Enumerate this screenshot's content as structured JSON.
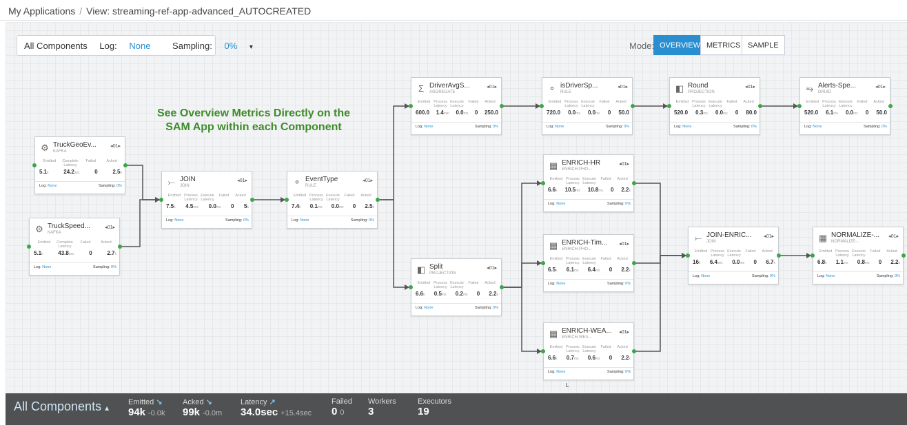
{
  "breadcrumb": {
    "root": "My Applications",
    "separator": "/",
    "current": "View: streaming-ref-app-advanced_AUTOCREATED"
  },
  "filter": {
    "components": "All Components",
    "log_label": "Log:",
    "log_value": "None",
    "sampling_label": "Sampling:",
    "sampling_value": "0%",
    "caret": "▾"
  },
  "mode": {
    "label": "Mode:",
    "options": [
      "OVERVIEW",
      "METRICS",
      "SAMPLE"
    ],
    "active": "OVERVIEW"
  },
  "callout": {
    "line1": "See Overview Metrics Directly on the",
    "line2": "SAM App within each Component"
  },
  "colors": {
    "accent": "#2a8fd1",
    "port": "#3ca64a",
    "callout": "#3e8b2b",
    "bottombar": "#4f5152"
  },
  "nodes": [
    {
      "id": "truckgeo",
      "name": "TruckGeoEv...",
      "type": "KAFKA",
      "icon": "kafka-icon",
      "parallelism": "01",
      "headers": [
        "Emitted",
        "Complete Latency",
        "Failed",
        "Acked"
      ],
      "values": [
        [
          "5.1",
          "k"
        ],
        [
          "24.2",
          "sec"
        ],
        [
          "0",
          ""
        ],
        [
          "2.5",
          "k"
        ]
      ],
      "log": "None",
      "sampling": "0%"
    },
    {
      "id": "truckspeed",
      "name": "TruckSpeed...",
      "type": "KAFKA",
      "icon": "kafka-icon",
      "parallelism": "01",
      "headers": [
        "Emitted",
        "Complete Latency",
        "Failed",
        "Acked"
      ],
      "values": [
        [
          "5.1",
          "k"
        ],
        [
          "43.8",
          "sec"
        ],
        [
          "0",
          ""
        ],
        [
          "2.7",
          "k"
        ]
      ],
      "log": "None",
      "sampling": "0%"
    },
    {
      "id": "join",
      "name": "JOIN",
      "type": "JOIN",
      "icon": "join-icon",
      "parallelism": "01",
      "headers": [
        "Emitted",
        "Process Latency",
        "Execute Latency",
        "Failed",
        "Acked"
      ],
      "values": [
        [
          "7.5",
          "k"
        ],
        [
          "4.5",
          "sec"
        ],
        [
          "0.0",
          "ms"
        ],
        [
          "0",
          ""
        ],
        [
          "5",
          "k"
        ]
      ],
      "log": "None",
      "sampling": "0%"
    },
    {
      "id": "eventtype",
      "name": "EventType",
      "type": "RULE",
      "icon": "rule-icon",
      "parallelism": "01",
      "headers": [
        "Emitted",
        "Process Latency",
        "Execute Latency",
        "Failed",
        "Acked"
      ],
      "values": [
        [
          "7.4",
          "k"
        ],
        [
          "0.1",
          "ms"
        ],
        [
          "0.0",
          "ms"
        ],
        [
          "0",
          ""
        ],
        [
          "2.5",
          "k"
        ]
      ],
      "log": "None",
      "sampling": "0%"
    },
    {
      "id": "driveravg",
      "name": "DriverAvgS...",
      "type": "AGGREGATE",
      "icon": "sigma-icon",
      "parallelism": "01",
      "headers": [
        "Emitted",
        "Process Latency",
        "Execute Latency",
        "Failed",
        "Acked"
      ],
      "values": [
        [
          "600.0",
          ""
        ],
        [
          "1.4",
          "min"
        ],
        [
          "0.0",
          "ms"
        ],
        [
          "0",
          ""
        ],
        [
          "250.0",
          ""
        ]
      ],
      "log": "None",
      "sampling": "0%"
    },
    {
      "id": "isdriver",
      "name": "isDriverSp...",
      "type": "RULE",
      "icon": "rule-icon",
      "parallelism": "01",
      "headers": [
        "Emitted",
        "Process Latency",
        "Execute Latency",
        "Failed",
        "Acked"
      ],
      "values": [
        [
          "720.0",
          ""
        ],
        [
          "0.0",
          "ms"
        ],
        [
          "0.0",
          "ms"
        ],
        [
          "0",
          ""
        ],
        [
          "50.0",
          ""
        ]
      ],
      "log": "None",
      "sampling": "0%"
    },
    {
      "id": "round",
      "name": "Round",
      "type": "PROJECTION",
      "icon": "projection-icon",
      "parallelism": "01",
      "headers": [
        "Emitted",
        "Process Latency",
        "Execute Latency",
        "Failed",
        "Acked"
      ],
      "values": [
        [
          "520.0",
          ""
        ],
        [
          "0.3",
          "ms"
        ],
        [
          "0.0",
          "ms"
        ],
        [
          "0",
          ""
        ],
        [
          "80.0",
          ""
        ]
      ],
      "log": "None",
      "sampling": "0%"
    },
    {
      "id": "alerts",
      "name": "Alerts-Spe...",
      "type": "DRUID",
      "icon": "druid-icon",
      "parallelism": "01",
      "headers": [
        "Emitted",
        "Process Latency",
        "Execute Latency",
        "Failed",
        "Acked"
      ],
      "values": [
        [
          "520.0",
          ""
        ],
        [
          "6.1",
          "ms"
        ],
        [
          "0.0",
          "ms"
        ],
        [
          "0",
          ""
        ],
        [
          "50.0",
          ""
        ]
      ],
      "log": "None",
      "sampling": "0%"
    },
    {
      "id": "split",
      "name": "Split",
      "type": "PROJECTION",
      "icon": "projection-icon",
      "parallelism": "01",
      "headers": [
        "Emitted",
        "Process Latency",
        "Execute Latency",
        "Failed",
        "Acked"
      ],
      "values": [
        [
          "6.6",
          "k"
        ],
        [
          "0.5",
          "ms"
        ],
        [
          "0.2",
          "ms"
        ],
        [
          "0",
          ""
        ],
        [
          "2.2",
          "k"
        ]
      ],
      "log": "None",
      "sampling": "0%"
    },
    {
      "id": "enrichhr",
      "name": "ENRICH-HR",
      "type": "ENRICH-PHO...",
      "icon": "enrich-icon",
      "parallelism": "01",
      "headers": [
        "Emitted",
        "Process Latency",
        "Execute Latency",
        "Failed",
        "Acked"
      ],
      "values": [
        [
          "6.6",
          "k"
        ],
        [
          "10.5",
          "ms"
        ],
        [
          "10.8",
          "ms"
        ],
        [
          "0",
          ""
        ],
        [
          "2.2",
          "k"
        ]
      ],
      "log": "None",
      "sampling": "0%"
    },
    {
      "id": "enrichtim",
      "name": "ENRICH-Tim...",
      "type": "ENRICH-PHO...",
      "icon": "enrich-icon",
      "parallelism": "01",
      "headers": [
        "Emitted",
        "Process Latency",
        "Execute Latency",
        "Failed",
        "Acked"
      ],
      "values": [
        [
          "6.5",
          "k"
        ],
        [
          "6.1",
          "ms"
        ],
        [
          "6.4",
          "ms"
        ],
        [
          "0",
          ""
        ],
        [
          "2.2",
          "k"
        ]
      ],
      "log": "None",
      "sampling": "0%"
    },
    {
      "id": "enrichwea",
      "name": "ENRICH-WEA...",
      "type": "ENRICH-WEA...",
      "icon": "enrich-icon",
      "parallelism": "01",
      "headers": [
        "Emitted",
        "Process Latency",
        "Execute Latency",
        "Failed",
        "Acked"
      ],
      "values": [
        [
          "6.6",
          "k"
        ],
        [
          "0.7",
          "ms"
        ],
        [
          "0.6",
          "ms"
        ],
        [
          "0",
          ""
        ],
        [
          "2.2",
          "k"
        ]
      ],
      "log": "None",
      "sampling": "0%"
    },
    {
      "id": "joinenric",
      "name": "JOIN-ENRIC...",
      "type": "JOIN",
      "icon": "join-icon",
      "parallelism": "01",
      "headers": [
        "Emitted",
        "Process Latency",
        "Execute Latency",
        "Failed",
        "Acked"
      ],
      "values": [
        [
          "16",
          "k"
        ],
        [
          "6.4",
          "sec"
        ],
        [
          "0.0",
          "ms"
        ],
        [
          "0",
          ""
        ],
        [
          "6.7",
          "k"
        ]
      ],
      "log": "None",
      "sampling": "0%"
    },
    {
      "id": "normalize",
      "name": "NORMALIZE-...",
      "type": "NORMALIZE-...",
      "icon": "enrich-icon",
      "parallelism": "01",
      "headers": [
        "Emitted",
        "Process Latency",
        "Execute Latency",
        "Failed",
        "Acked"
      ],
      "values": [
        [
          "6.8",
          "k"
        ],
        [
          "1.1",
          "ms"
        ],
        [
          "0.8",
          "ms"
        ],
        [
          "0",
          ""
        ],
        [
          "2.2",
          "k"
        ]
      ],
      "log": "None",
      "sampling": "0%"
    }
  ],
  "footer_labels": {
    "log": "Log:",
    "sampling": "Sampling:"
  },
  "canvas_marker": "L",
  "bottom": {
    "title": "All Components",
    "caret": "▴",
    "stats": [
      {
        "label": "Emitted",
        "trend": "down",
        "value": "94k",
        "delta": "-0.0k"
      },
      {
        "label": "Acked",
        "trend": "down",
        "value": "99k",
        "delta": "-0.0m"
      },
      {
        "label": "Latency",
        "trend": "up",
        "value": "34.0sec",
        "delta": "+15.4sec"
      },
      {
        "label": "Failed",
        "trend": "",
        "value": "0",
        "delta": "0"
      },
      {
        "label": "Workers",
        "trend": "",
        "value": "3",
        "delta": ""
      },
      {
        "label": "Executors",
        "trend": "",
        "value": "19",
        "delta": ""
      }
    ]
  }
}
